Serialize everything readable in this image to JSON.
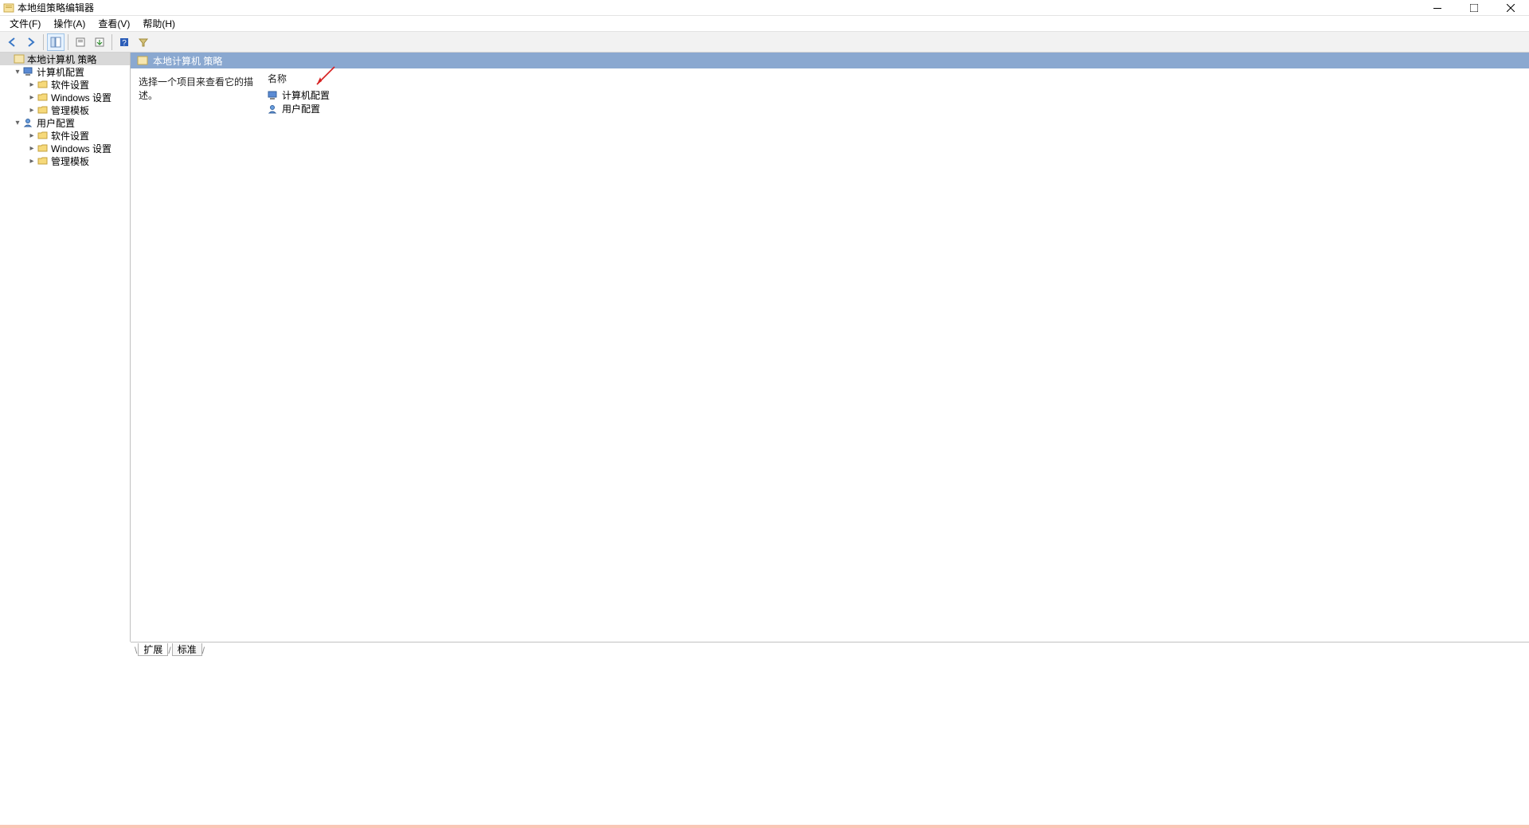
{
  "window": {
    "title": "本地组策略编辑器"
  },
  "menu": {
    "file": "文件(F)",
    "action": "操作(A)",
    "view": "查看(V)",
    "help": "帮助(H)"
  },
  "tree": {
    "root": "本地计算机 策略",
    "computer_config": "计算机配置",
    "user_config": "用户配置",
    "software_settings": "软件设置",
    "windows_settings": "Windows 设置",
    "admin_templates": "管理模板"
  },
  "right": {
    "header": "本地计算机 策略",
    "description": "选择一个项目来查看它的描述。",
    "column_name": "名称",
    "items": {
      "computer_config": "计算机配置",
      "user_config": "用户配置"
    }
  },
  "tabs": {
    "extended": "扩展",
    "standard": "标准"
  }
}
